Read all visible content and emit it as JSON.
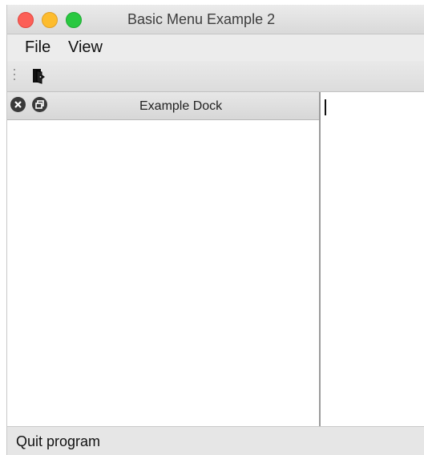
{
  "window": {
    "title": "Basic Menu Example 2"
  },
  "menubar": {
    "items": [
      {
        "label": "File"
      },
      {
        "label": "View"
      }
    ]
  },
  "toolbar": {
    "actions": [
      {
        "icon": "exit-door-icon"
      }
    ]
  },
  "dock": {
    "title": "Example Dock",
    "buttons": [
      "close-icon",
      "float-icon"
    ]
  },
  "statusbar": {
    "message": "Quit program"
  },
  "colors": {
    "close": "#fc5f57",
    "minimize": "#fdbc2e",
    "maximize": "#29c840"
  }
}
